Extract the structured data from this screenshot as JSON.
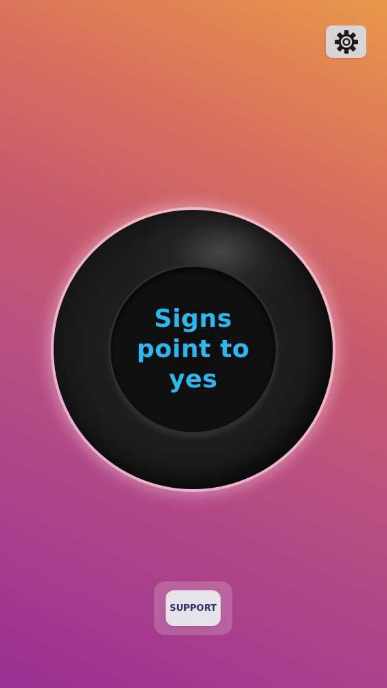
{
  "header": {
    "settings_icon": "gear-icon"
  },
  "ball": {
    "answer": "Signs point to yes",
    "answer_color": "#29b8f0"
  },
  "footer": {
    "support_label": "SUPPORT"
  },
  "colors": {
    "gradient_top_right": "#e9974a",
    "gradient_bottom_left": "#9b2f93",
    "ball": "#1c1c1c"
  }
}
